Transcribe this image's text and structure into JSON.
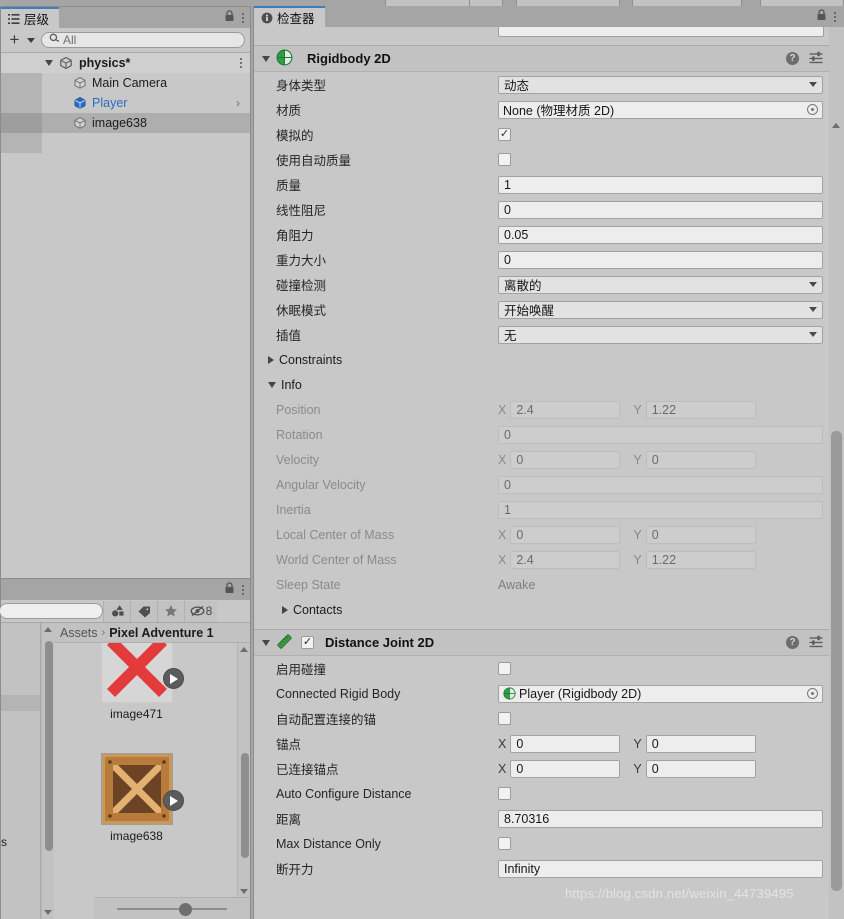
{
  "theme": {
    "panel_bg": "#c8c8c8",
    "chrome_bg": "#a5a5a5",
    "accent_tab": "#3d7ebf",
    "selection": "#aeaeae",
    "link_blue": "#2d6cc0",
    "rigidbody_green": "#2f9e44",
    "joint_green": "#3f9b3f"
  },
  "hierarchy": {
    "tab_label": "层级",
    "tab_icon": "list-icon",
    "lock_icon": "lock-icon",
    "menu_icon": "kebab-menu-icon",
    "add_button_label": "+",
    "search": {
      "value": "All",
      "placeholder": "All",
      "icon": "search-icon"
    },
    "items": [
      {
        "label": "physics*",
        "icon": "scene-icon",
        "depth": 0,
        "expanded": true,
        "selected": false,
        "has_menu": true,
        "modified": true
      },
      {
        "label": "Main Camera",
        "icon": "gameobject-cube-icon",
        "depth": 1,
        "selected": false
      },
      {
        "label": "Player",
        "icon": "prefab-cube-icon",
        "depth": 1,
        "selected": false,
        "is_prefab": true,
        "has_chevron": true
      },
      {
        "label": "image638",
        "icon": "gameobject-cube-icon",
        "depth": 1,
        "selected": true
      }
    ]
  },
  "project": {
    "lock_icon": "lock-icon",
    "menu_icon": "kebab-menu-icon",
    "search": {
      "value": "",
      "placeholder": ""
    },
    "toolbar_icons": [
      {
        "name": "filter-by-type-icon"
      },
      {
        "name": "filter-by-label-icon"
      },
      {
        "name": "favorites-star-icon"
      },
      {
        "name": "hidden-items-icon",
        "count": "8"
      }
    ],
    "breadcrumb": {
      "root": "Assets",
      "separator": "›",
      "current": "Pixel Adventure 1"
    },
    "assets": [
      {
        "label": "image471",
        "thumb": "red-x-sprite",
        "selected": false,
        "has_play_badge": true
      },
      {
        "label": "image638",
        "thumb": "wooden-crate-sprite",
        "selected": true,
        "has_play_badge": true
      }
    ],
    "zoom_slider_percent": 58
  },
  "inspector": {
    "tab_label": "检查器",
    "tab_icon": "info-icon",
    "lock_icon": "lock-icon",
    "menu_icon": "kebab-menu-icon",
    "components": [
      {
        "name": "rigidbody-2d",
        "title": "Rigidbody 2D",
        "icon": "rigidbody-2d-icon",
        "expanded": true,
        "has_enable_checkbox": false,
        "header_icons": [
          "help-icon",
          "preset-icon",
          "kebab-menu-icon"
        ],
        "fields": [
          {
            "name": "body-type",
            "label": "身体类型",
            "type": "dropdown",
            "value": "动态"
          },
          {
            "name": "material",
            "label": "材质",
            "type": "object",
            "value": "None (物理材质 2D)"
          },
          {
            "name": "simulated",
            "label": "模拟的",
            "type": "checkbox",
            "checked": true
          },
          {
            "name": "use-auto-mass",
            "label": "使用自动质量",
            "type": "checkbox",
            "checked": false
          },
          {
            "name": "mass",
            "label": "质量",
            "type": "text",
            "value": "1"
          },
          {
            "name": "linear-damping",
            "label": "线性阻尼",
            "type": "text",
            "value": "0"
          },
          {
            "name": "angular-damping",
            "label": "角阻力",
            "type": "text",
            "value": "0.05"
          },
          {
            "name": "gravity-scale",
            "label": "重力大小",
            "type": "text",
            "value": "0"
          },
          {
            "name": "collision-detection",
            "label": "碰撞检测",
            "type": "dropdown",
            "value": "离散的"
          },
          {
            "name": "sleeping-mode",
            "label": "休眠模式",
            "type": "dropdown",
            "value": "开始唤醒"
          },
          {
            "name": "interpolate",
            "label": "插值",
            "type": "dropdown",
            "value": "无"
          }
        ],
        "foldouts": [
          {
            "name": "constraints",
            "label": "Constraints",
            "expanded": false
          },
          {
            "name": "info",
            "label": "Info",
            "expanded": true
          }
        ],
        "info_fields": [
          {
            "name": "position",
            "label": "Position",
            "type": "xy",
            "x": "2.4",
            "y": "1.22"
          },
          {
            "name": "rotation",
            "label": "Rotation",
            "type": "text",
            "value": "0"
          },
          {
            "name": "velocity",
            "label": "Velocity",
            "type": "xy",
            "x": "0",
            "y": "0"
          },
          {
            "name": "angular-velocity",
            "label": "Angular Velocity",
            "type": "text",
            "value": "0"
          },
          {
            "name": "inertia",
            "label": "Inertia",
            "type": "text",
            "value": "1"
          },
          {
            "name": "local-center-of-mass",
            "label": "Local Center of Mass",
            "type": "xy",
            "x": "0",
            "y": "0"
          },
          {
            "name": "world-center-of-mass",
            "label": "World Center of Mass",
            "type": "xy",
            "x": "2.4",
            "y": "1.22"
          },
          {
            "name": "sleep-state",
            "label": "Sleep State",
            "type": "static",
            "value": "Awake"
          }
        ],
        "contacts_foldout": {
          "name": "contacts",
          "label": "Contacts",
          "expanded": false
        }
      },
      {
        "name": "distance-joint-2d",
        "title": "Distance Joint 2D",
        "icon": "distance-joint-2d-icon",
        "expanded": true,
        "has_enable_checkbox": true,
        "enabled": true,
        "header_icons": [
          "help-icon",
          "preset-icon",
          "kebab-menu-icon"
        ],
        "fields": [
          {
            "name": "enable-collision",
            "label": "启用碰撞",
            "type": "checkbox",
            "checked": false
          },
          {
            "name": "connected-rigid-body",
            "label": "Connected Rigid Body",
            "type": "object",
            "value": "Player (Rigidbody 2D)",
            "icon": "rigidbody-2d-icon"
          },
          {
            "name": "auto-configure-connected-anchor",
            "label": "自动配置连接的锚",
            "type": "checkbox",
            "checked": false
          },
          {
            "name": "anchor",
            "label": "锚点",
            "type": "xy",
            "x": "0",
            "y": "0"
          },
          {
            "name": "connected-anchor",
            "label": "已连接锚点",
            "type": "xy",
            "x": "0",
            "y": "0"
          },
          {
            "name": "auto-configure-distance",
            "label": "Auto Configure Distance",
            "type": "checkbox",
            "checked": false
          },
          {
            "name": "distance",
            "label": "距离",
            "type": "text",
            "value": "8.70316"
          },
          {
            "name": "max-distance-only",
            "label": "Max Distance Only",
            "type": "checkbox",
            "checked": false
          },
          {
            "name": "break-force",
            "label": "断开力",
            "type": "text",
            "value": "Infinity"
          }
        ]
      }
    ]
  },
  "watermark": "https://blog.csdn.net/weixin_44739495"
}
